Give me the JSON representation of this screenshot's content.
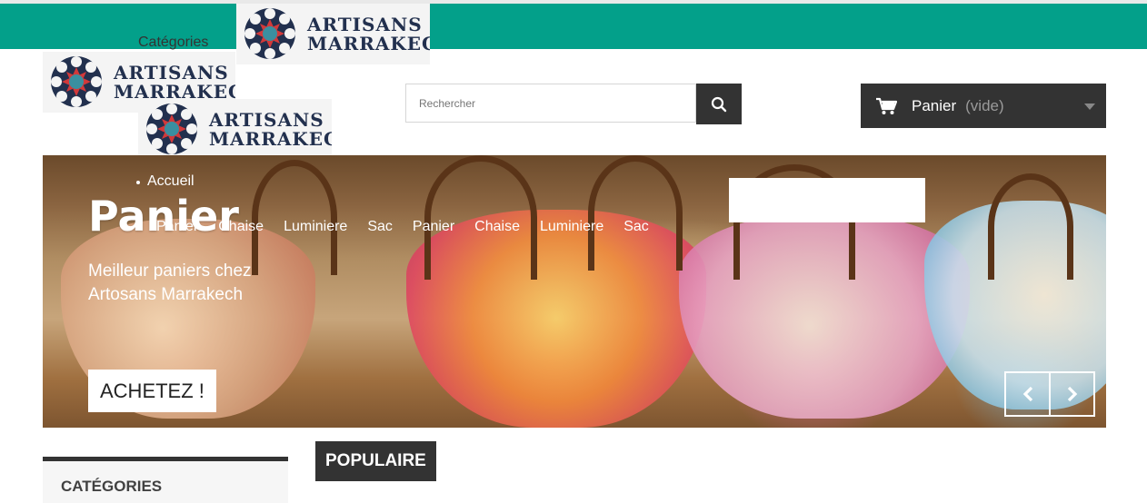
{
  "header": {
    "categories_link": "Catégories",
    "logo_text_line1": "ARTISANS",
    "logo_text_line2": "MARRAKECH"
  },
  "search": {
    "placeholder": "Rechercher",
    "button_icon": "search-icon"
  },
  "cart": {
    "label": "Panier",
    "status": "(vide)",
    "icon": "cart-icon"
  },
  "hero": {
    "breadcrumb": "Accueil",
    "title": "Panier",
    "menu": [
      "Panier",
      "Chaise",
      "Luminiere",
      "Sac",
      "Panier",
      "Chaise",
      "Luminiere",
      "Sac"
    ],
    "text": "Meilleur paniers chez Artosans Marrakech",
    "cta_label": "ACHETEZ !"
  },
  "sidebar": {
    "categories_title": "CATÉGORIES"
  },
  "main": {
    "section_title": "POPULAIRE"
  },
  "colors": {
    "topbar": "#03a08a",
    "dark": "#333333",
    "logo_text": "#22304e"
  }
}
